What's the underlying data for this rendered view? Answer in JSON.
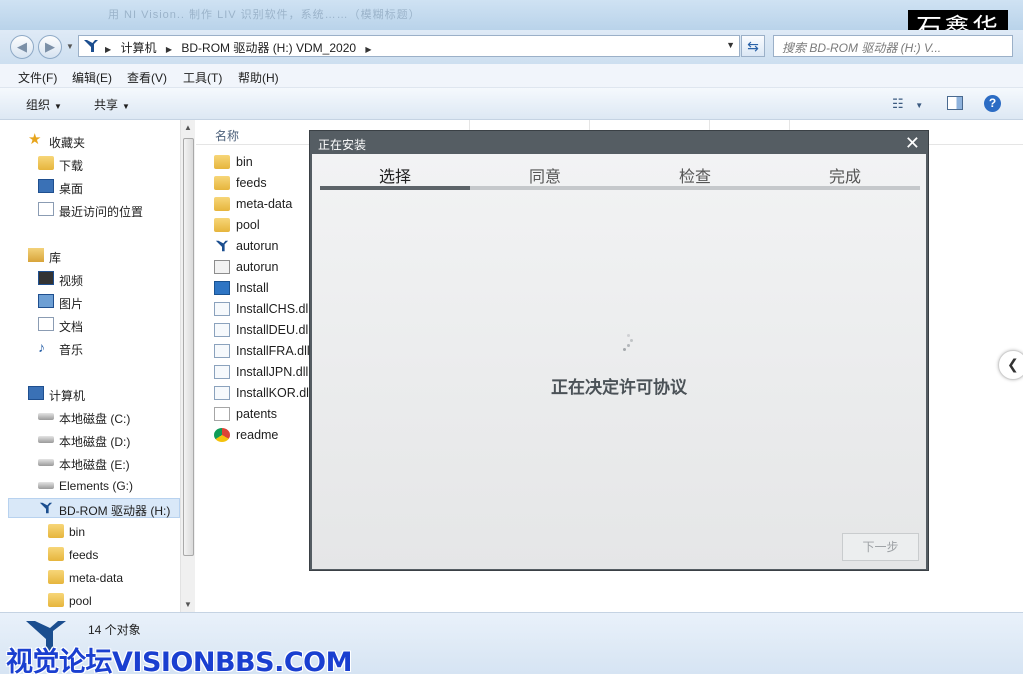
{
  "window": {
    "blurred_title": "用 NI Vision.. 制作 LIV 识别软件，系统……（模糊标题）",
    "logo": {
      "text": "石鑫华",
      "mark": "®"
    }
  },
  "address": {
    "crumbs": [
      "计算机",
      "BD-ROM 驱动器 (H:) VDM_2020"
    ],
    "search_placeholder": "搜索 BD-ROM 驱动器 (H:) V..."
  },
  "menu": [
    "文件(F)",
    "编辑(E)",
    "查看(V)",
    "工具(T)",
    "帮助(H)"
  ],
  "toolbar": {
    "organize": "组织",
    "share": "共享"
  },
  "nav": {
    "favorites": {
      "label": "收藏夹",
      "items": [
        "下载",
        "桌面",
        "最近访问的位置"
      ]
    },
    "libraries": {
      "label": "库",
      "items": [
        "视频",
        "图片",
        "文档",
        "音乐"
      ]
    },
    "computer": {
      "label": "计算机",
      "items": [
        "本地磁盘 (C:)",
        "本地磁盘 (D:)",
        "本地磁盘 (E:)",
        "Elements (G:)",
        "BD-ROM 驱动器 (H:)"
      ]
    },
    "subfolders": [
      "bin",
      "feeds",
      "meta-data",
      "pool"
    ]
  },
  "columns": {
    "name": "名称"
  },
  "files": [
    {
      "name": "bin",
      "icon": "folder-icon"
    },
    {
      "name": "feeds",
      "icon": "folder-icon"
    },
    {
      "name": "meta-data",
      "icon": "folder-icon"
    },
    {
      "name": "pool",
      "icon": "folder-icon"
    },
    {
      "name": "autorun",
      "icon": "ni-logo-icon"
    },
    {
      "name": "autorun",
      "icon": "config-file-icon"
    },
    {
      "name": "Install",
      "icon": "installer-icon"
    },
    {
      "name": "InstallCHS.dll",
      "icon": "dll-icon"
    },
    {
      "name": "InstallDEU.dll",
      "icon": "dll-icon"
    },
    {
      "name": "InstallFRA.dll",
      "icon": "dll-icon"
    },
    {
      "name": "InstallJPN.dll",
      "icon": "dll-icon"
    },
    {
      "name": "InstallKOR.dll",
      "icon": "dll-icon"
    },
    {
      "name": "patents",
      "icon": "text-file-icon"
    },
    {
      "name": "readme",
      "icon": "chrome-html-icon"
    }
  ],
  "status": {
    "count": "14 个对象"
  },
  "watermark": "视觉论坛VISIONBBS.COM",
  "dialog": {
    "title": "正在安装",
    "close": "✕",
    "steps": [
      "选择",
      "同意",
      "检查",
      "完成"
    ],
    "active_step": 0,
    "progress_fraction": 0.25,
    "message": "正在决定许可协议",
    "next_button": "下一步"
  }
}
